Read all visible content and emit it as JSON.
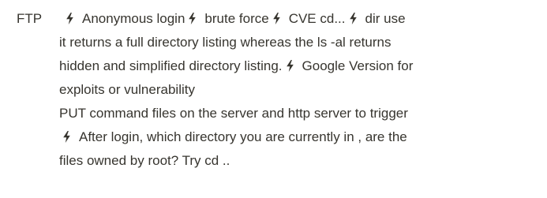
{
  "note": {
    "label": "FTP",
    "lines": [
      {
        "segments": [
          {
            "bolt": true
          },
          {
            "text": "Anonymous login"
          },
          {
            "bolt": true
          },
          {
            "text": "brute force"
          },
          {
            "bolt": true
          },
          {
            "text": "CVE cd..."
          },
          {
            "bolt": true
          },
          {
            "text": "dir use"
          }
        ]
      },
      {
        "segments": [
          {
            "text": "it returns a full directory listing whereas the ls -al returns"
          }
        ]
      },
      {
        "segments": [
          {
            "text": "hidden and simplified directory listing."
          },
          {
            "bolt": true
          },
          {
            "text": "Google Version for"
          }
        ]
      },
      {
        "segments": [
          {
            "text": "exploits or vulnerability"
          }
        ]
      },
      {
        "segments": [
          {
            "text": "PUT command files on the server and http server to trigger"
          }
        ]
      },
      {
        "segments": [
          {
            "bolt": true
          },
          {
            "text": "After login, which directory you are currently in , are the"
          }
        ]
      },
      {
        "segments": [
          {
            "text": "files owned by root? Try cd .."
          }
        ]
      }
    ],
    "icon": "lightning-bolt-icon",
    "colors": {
      "text": "#37352f",
      "bolt": "#37352f",
      "background": "#ffffff"
    }
  }
}
